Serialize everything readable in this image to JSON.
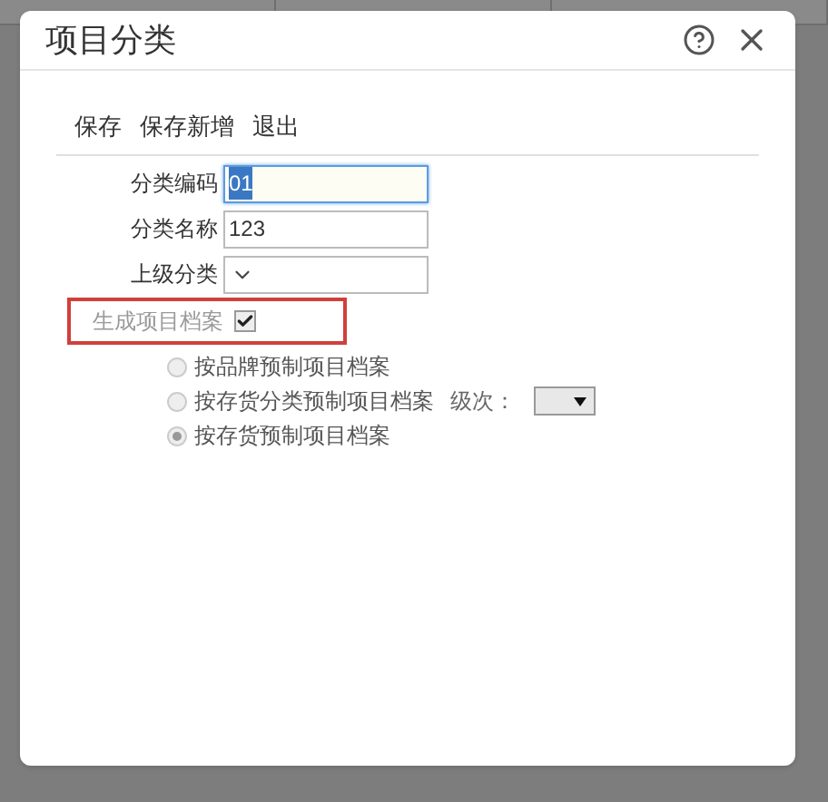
{
  "dialog": {
    "title": "项目分类"
  },
  "toolbar": [
    "保存",
    "保存新增",
    "退出"
  ],
  "fields": [
    {
      "label": "分类编码",
      "kind": "text",
      "value": "01",
      "focused": true
    },
    {
      "label": "分类名称",
      "kind": "text",
      "value": "123",
      "focused": false
    },
    {
      "label": "上级分类",
      "kind": "select"
    }
  ],
  "generate": {
    "label": "生成项目档案",
    "checked": true
  },
  "options": [
    {
      "label": "按品牌预制项目档案",
      "selected": false
    },
    {
      "label": "按存货分类预制项目档案",
      "selected": false,
      "level_label": "级次："
    },
    {
      "label": "按存货预制项目档案",
      "selected": true
    }
  ]
}
